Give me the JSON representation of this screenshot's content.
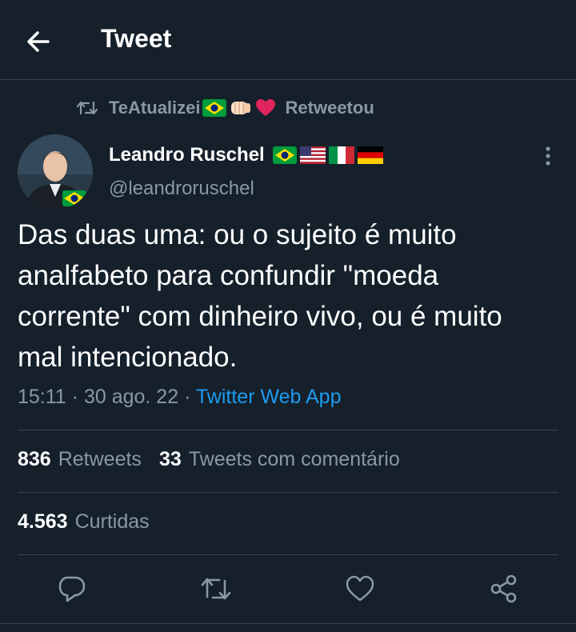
{
  "header": {
    "title": "Tweet",
    "back_icon": "arrow-left-icon"
  },
  "retweet_context": {
    "icon": "retweet-icon",
    "user": "TeAtualizei",
    "emojis": [
      "brazil-flag",
      "fist-bump",
      "red-heart"
    ],
    "suffix": "Retweetou"
  },
  "author": {
    "name": "Leandro Ruschel",
    "handle": "@leandroruschel",
    "flags": [
      "brazil-flag",
      "usa-flag",
      "italy-flag",
      "germany-flag"
    ]
  },
  "tweet": {
    "text": "Das duas uma: ou o sujeito é muito analfabeto para confundir \"moeda corrente\" com dinheiro vivo, ou é muito mal intencionado.",
    "time": "15:11",
    "separator1": "·",
    "date": "30 ago. 22",
    "separator2": "·",
    "source": "Twitter Web App"
  },
  "stats": {
    "retweets": {
      "count": "836",
      "label": "Retweets"
    },
    "quotes": {
      "count": "33",
      "label": "Tweets com comentário"
    },
    "likes": {
      "count": "4.563",
      "label": "Curtidas"
    }
  },
  "actions": [
    "reply-icon",
    "retweet-icon",
    "like-icon",
    "share-icon"
  ],
  "colors": {
    "background": "#15202b",
    "secondary_text": "#8899a6",
    "link": "#1d9bf0",
    "divider": "#38444d"
  }
}
